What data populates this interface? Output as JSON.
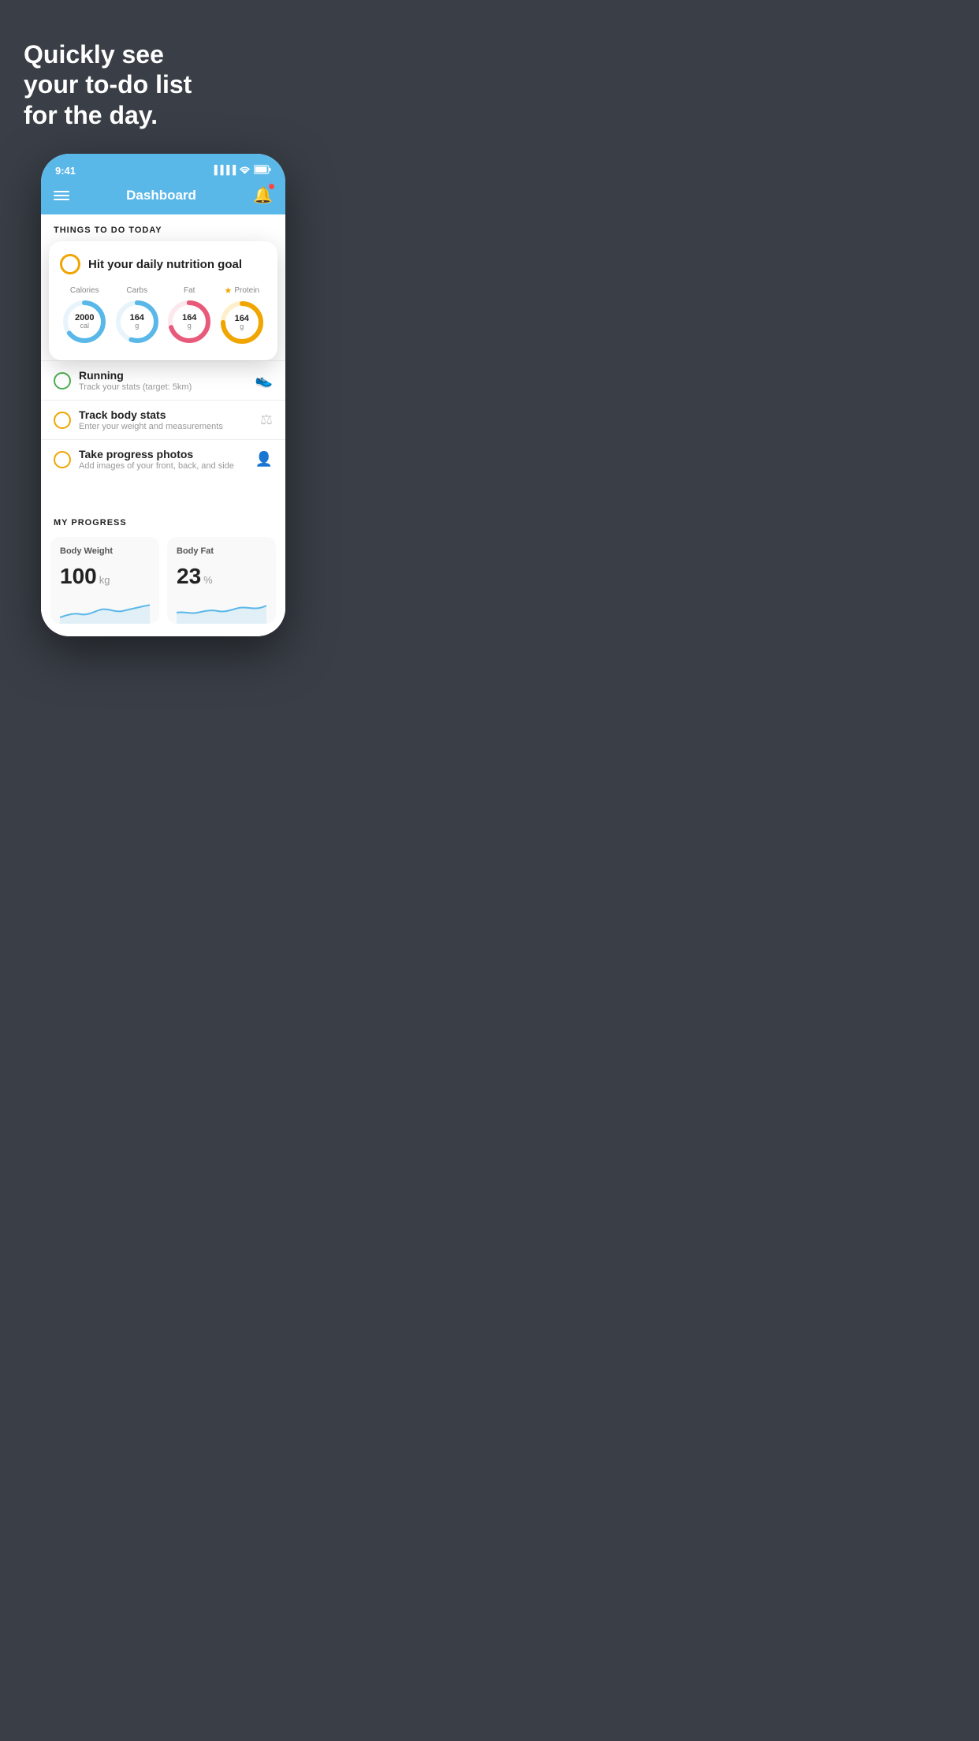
{
  "hero": {
    "title": "Quickly see\nyour to-do list\nfor the day."
  },
  "phone": {
    "status": {
      "time": "9:41",
      "signal": "▐▐▐▐",
      "wifi": "wifi",
      "battery": "battery"
    },
    "nav": {
      "title": "Dashboard"
    },
    "things_today": {
      "header": "THINGS TO DO TODAY"
    },
    "nutrition_card": {
      "title": "Hit your daily nutrition goal",
      "metrics": [
        {
          "label": "Calories",
          "value": "2000",
          "unit": "cal",
          "color": "#5ab8e8",
          "pct": 65
        },
        {
          "label": "Carbs",
          "value": "164",
          "unit": "g",
          "color": "#5ab8e8",
          "pct": 55
        },
        {
          "label": "Fat",
          "value": "164",
          "unit": "g",
          "color": "#e85a7a",
          "pct": 70
        },
        {
          "label": "Protein",
          "value": "164",
          "unit": "g",
          "color": "#f0a500",
          "pct": 75,
          "starred": true
        }
      ]
    },
    "todo_items": [
      {
        "title": "Running",
        "subtitle": "Track your stats (target: 5km)",
        "circle_color": "green",
        "icon": "👟"
      },
      {
        "title": "Track body stats",
        "subtitle": "Enter your weight and measurements",
        "circle_color": "yellow",
        "icon": "⚖"
      },
      {
        "title": "Take progress photos",
        "subtitle": "Add images of your front, back, and side",
        "circle_color": "yellow",
        "icon": "👤"
      }
    ],
    "progress": {
      "header": "MY PROGRESS",
      "cards": [
        {
          "title": "Body Weight",
          "value": "100",
          "unit": "kg"
        },
        {
          "title": "Body Fat",
          "value": "23",
          "unit": "%"
        }
      ]
    }
  }
}
